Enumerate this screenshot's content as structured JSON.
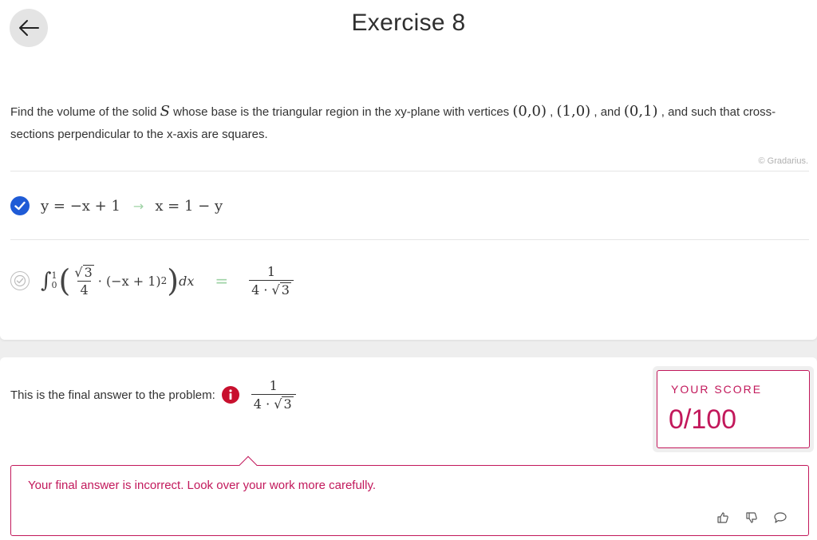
{
  "header": {
    "title": "Exercise 8"
  },
  "problem": {
    "text_1": "Find the volume of the solid ",
    "math_S": "S",
    "text_2": " whose base is the triangular region in the xy-plane with vertices ",
    "v1": "(0,0)",
    "sep1": " , ",
    "v2": "(1,0)",
    "sep2": " , and ",
    "v3": "(0,1)",
    "text_3": " , and such that cross-sections perpendicular to the x-axis are squares.",
    "copyright": "© Gradarius."
  },
  "steps": [
    {
      "status": "correct",
      "lhs": "y = −x + 1",
      "rhs": "x = 1 − y"
    },
    {
      "status": "pending",
      "integral_upper": "1",
      "integral_lower": "0",
      "coef_num": "3",
      "coef_den": "4",
      "body": "· (−x + 1)",
      "power": "2",
      "dx": "dx",
      "result_num": "1",
      "result_den_a": "4 · ",
      "result_den_b": "3"
    }
  ],
  "final": {
    "label": "This is the final answer to the problem:",
    "answer_num": "1",
    "answer_den_a": "4 · ",
    "answer_den_b": "3"
  },
  "score": {
    "label": "YOUR SCORE",
    "value": "0/100"
  },
  "feedback": {
    "message": "Your final answer is incorrect. Look over your work more carefully."
  },
  "colors": {
    "accent_blue": "#1f5bd6",
    "error_crimson": "#c2185b",
    "info_red": "#c8102e",
    "arrow_green": "#9fd3a6"
  }
}
